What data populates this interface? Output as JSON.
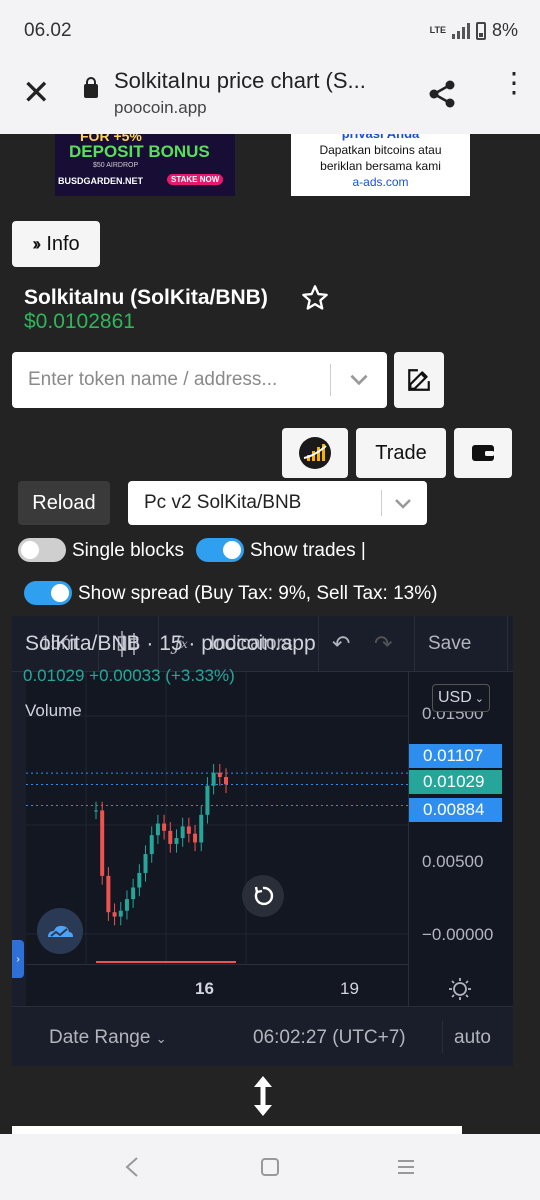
{
  "status": {
    "time": "06.02",
    "network": "LTE",
    "battery": "8%"
  },
  "browser": {
    "page_title": "SolkitaInu price chart (S...",
    "domain": "poocoin.app"
  },
  "ads": {
    "left": {
      "line1": "FOR +5%",
      "line2": "DEPOSIT BONUS",
      "line3": "$50 AIRDROP",
      "line4": "BUSDGARDEN.NET",
      "cta": "STAKE NOW"
    },
    "right": {
      "line1": "privasi Anda",
      "line2": "Dapatkan bitcoins atau",
      "line3": "beriklan bersama kami",
      "line4": "a-ads.com"
    }
  },
  "info_button": "Info",
  "token": {
    "name": "SolkitaInu (SolKita/BNB)",
    "price": "$0.0102861"
  },
  "search": {
    "placeholder": "Enter token name / address..."
  },
  "trade_button": "Trade",
  "reload_button": "Reload",
  "pair_select": "Pc v2 SolKita/BNB",
  "toggles": {
    "single_blocks": {
      "label": "Single blocks",
      "on": false
    },
    "show_trades": {
      "label": "Show trades |",
      "on": true
    },
    "show_spread": {
      "label": "Show spread (Buy Tax: 9%, Sell Tax: 13%)",
      "on": true
    }
  },
  "tv": {
    "toolbar": {
      "interval": "15m",
      "indicators": "Indicators",
      "save": "Save"
    },
    "legend": {
      "title": "SolKita/BNB · 15 · poocoin.app",
      "values": "0.01029  +0.00033 (+3.33%)",
      "volume": "Volume"
    },
    "currency": "USD",
    "price_tags": [
      {
        "value": "0.01107",
        "color": "#2e8ef0"
      },
      {
        "value": "0.01029",
        "color": "#26a69a"
      },
      {
        "value": "0.00884",
        "color": "#2e8ef0"
      }
    ],
    "y_ticks": [
      "0.01500",
      "0.00500",
      "−0.00000"
    ],
    "x_ticks": [
      "16",
      "19"
    ],
    "bottom": {
      "date_range": "Date Range",
      "time": "06:02:27 (UTC+7)",
      "scale": "auto"
    },
    "colors": {
      "up": "#26a69a",
      "down": "#ef5350",
      "background": "#131722"
    }
  },
  "chart_data": {
    "type": "line",
    "title": "SolKita/BNB · 15 · poocoin.app",
    "xlabel": "",
    "ylabel": "",
    "x_ticks": [
      "16",
      "19"
    ],
    "ylim": [
      0,
      0.015
    ],
    "series": [
      {
        "values": [
          0.0085,
          0.004,
          0.0015,
          0.0012,
          0.0016,
          0.0024,
          0.0032,
          0.0042,
          0.0055,
          0.0068,
          0.0076,
          0.0071,
          0.0062,
          0.0066,
          0.0074,
          0.0069,
          0.0063,
          0.0082,
          0.0102,
          0.0111,
          0.0108,
          0.0103
        ]
      }
    ]
  }
}
